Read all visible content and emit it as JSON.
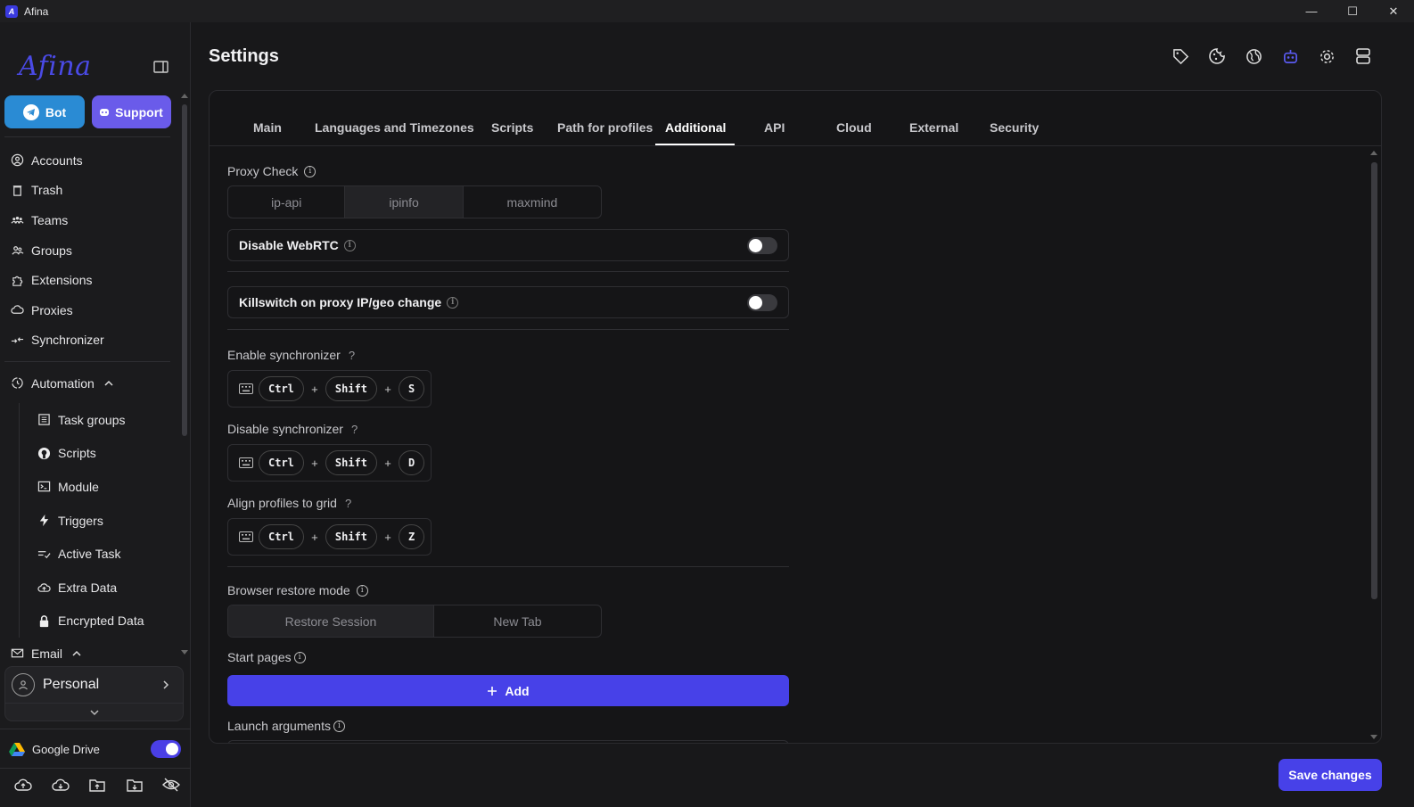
{
  "window": {
    "title": "Afina",
    "minimize": "—",
    "maximize": "☐",
    "close": "✕"
  },
  "sidebar": {
    "logo": "Afina",
    "bot_label": "Bot",
    "support_label": "Support",
    "items": [
      {
        "label": "Accounts",
        "icon": "user-circle-icon"
      },
      {
        "label": "Trash",
        "icon": "trash-icon"
      },
      {
        "label": "Teams",
        "icon": "team-icon"
      },
      {
        "label": "Groups",
        "icon": "group-icon"
      },
      {
        "label": "Extensions",
        "icon": "puzzle-icon"
      },
      {
        "label": "Proxies",
        "icon": "cloud-icon"
      },
      {
        "label": "Synchronizer",
        "icon": "sync-icon"
      }
    ],
    "automation_label": "Automation",
    "automation_items": [
      {
        "label": "Task groups",
        "icon": "list-icon"
      },
      {
        "label": "Scripts",
        "icon": "github-icon"
      },
      {
        "label": "Module",
        "icon": "terminal-icon"
      },
      {
        "label": "Triggers",
        "icon": "bolt-icon"
      },
      {
        "label": "Active Task",
        "icon": "task-list-icon"
      },
      {
        "label": "Extra Data",
        "icon": "cloud-upload-icon"
      },
      {
        "label": "Encrypted Data",
        "icon": "lock-icon"
      }
    ],
    "email_label": "Email",
    "profile_name": "Personal",
    "gdrive_label": "Google Drive"
  },
  "header": {
    "title": "Settings"
  },
  "tabs": [
    "Main",
    "Languages and Timezones",
    "Scripts",
    "Path for profiles",
    "Additional",
    "API",
    "Cloud",
    "External",
    "Security"
  ],
  "active_tab": "Additional",
  "settings": {
    "proxy_check_label": "Proxy Check",
    "proxy_check_options": [
      "ip-api",
      "ipinfo",
      "maxmind"
    ],
    "proxy_check_selected": "ipinfo",
    "disable_webrtc_label": "Disable WebRTC",
    "killswitch_label": "Killswitch on proxy IP/geo change",
    "enable_sync_label": "Enable synchronizer",
    "enable_sync_keys": [
      "Ctrl",
      "Shift",
      "S"
    ],
    "disable_sync_label": "Disable synchronizer",
    "disable_sync_keys": [
      "Ctrl",
      "Shift",
      "D"
    ],
    "align_grid_label": "Align profiles to grid",
    "align_grid_keys": [
      "Ctrl",
      "Shift",
      "Z"
    ],
    "restore_mode_label": "Browser restore mode",
    "restore_mode_options": [
      "Restore Session",
      "New Tab"
    ],
    "restore_mode_selected": "Restore Session",
    "start_pages_label": "Start pages",
    "add_label": "Add",
    "launch_args_label": "Launch arguments",
    "plus_sign": "+",
    "question_mark": "?",
    "info_sign": "i"
  },
  "save_label": "Save changes",
  "colors": {
    "accent": "#4741e8",
    "bot": "#2a8bd4",
    "support": "#6a5bea",
    "active_icon": "#5a5af0"
  }
}
